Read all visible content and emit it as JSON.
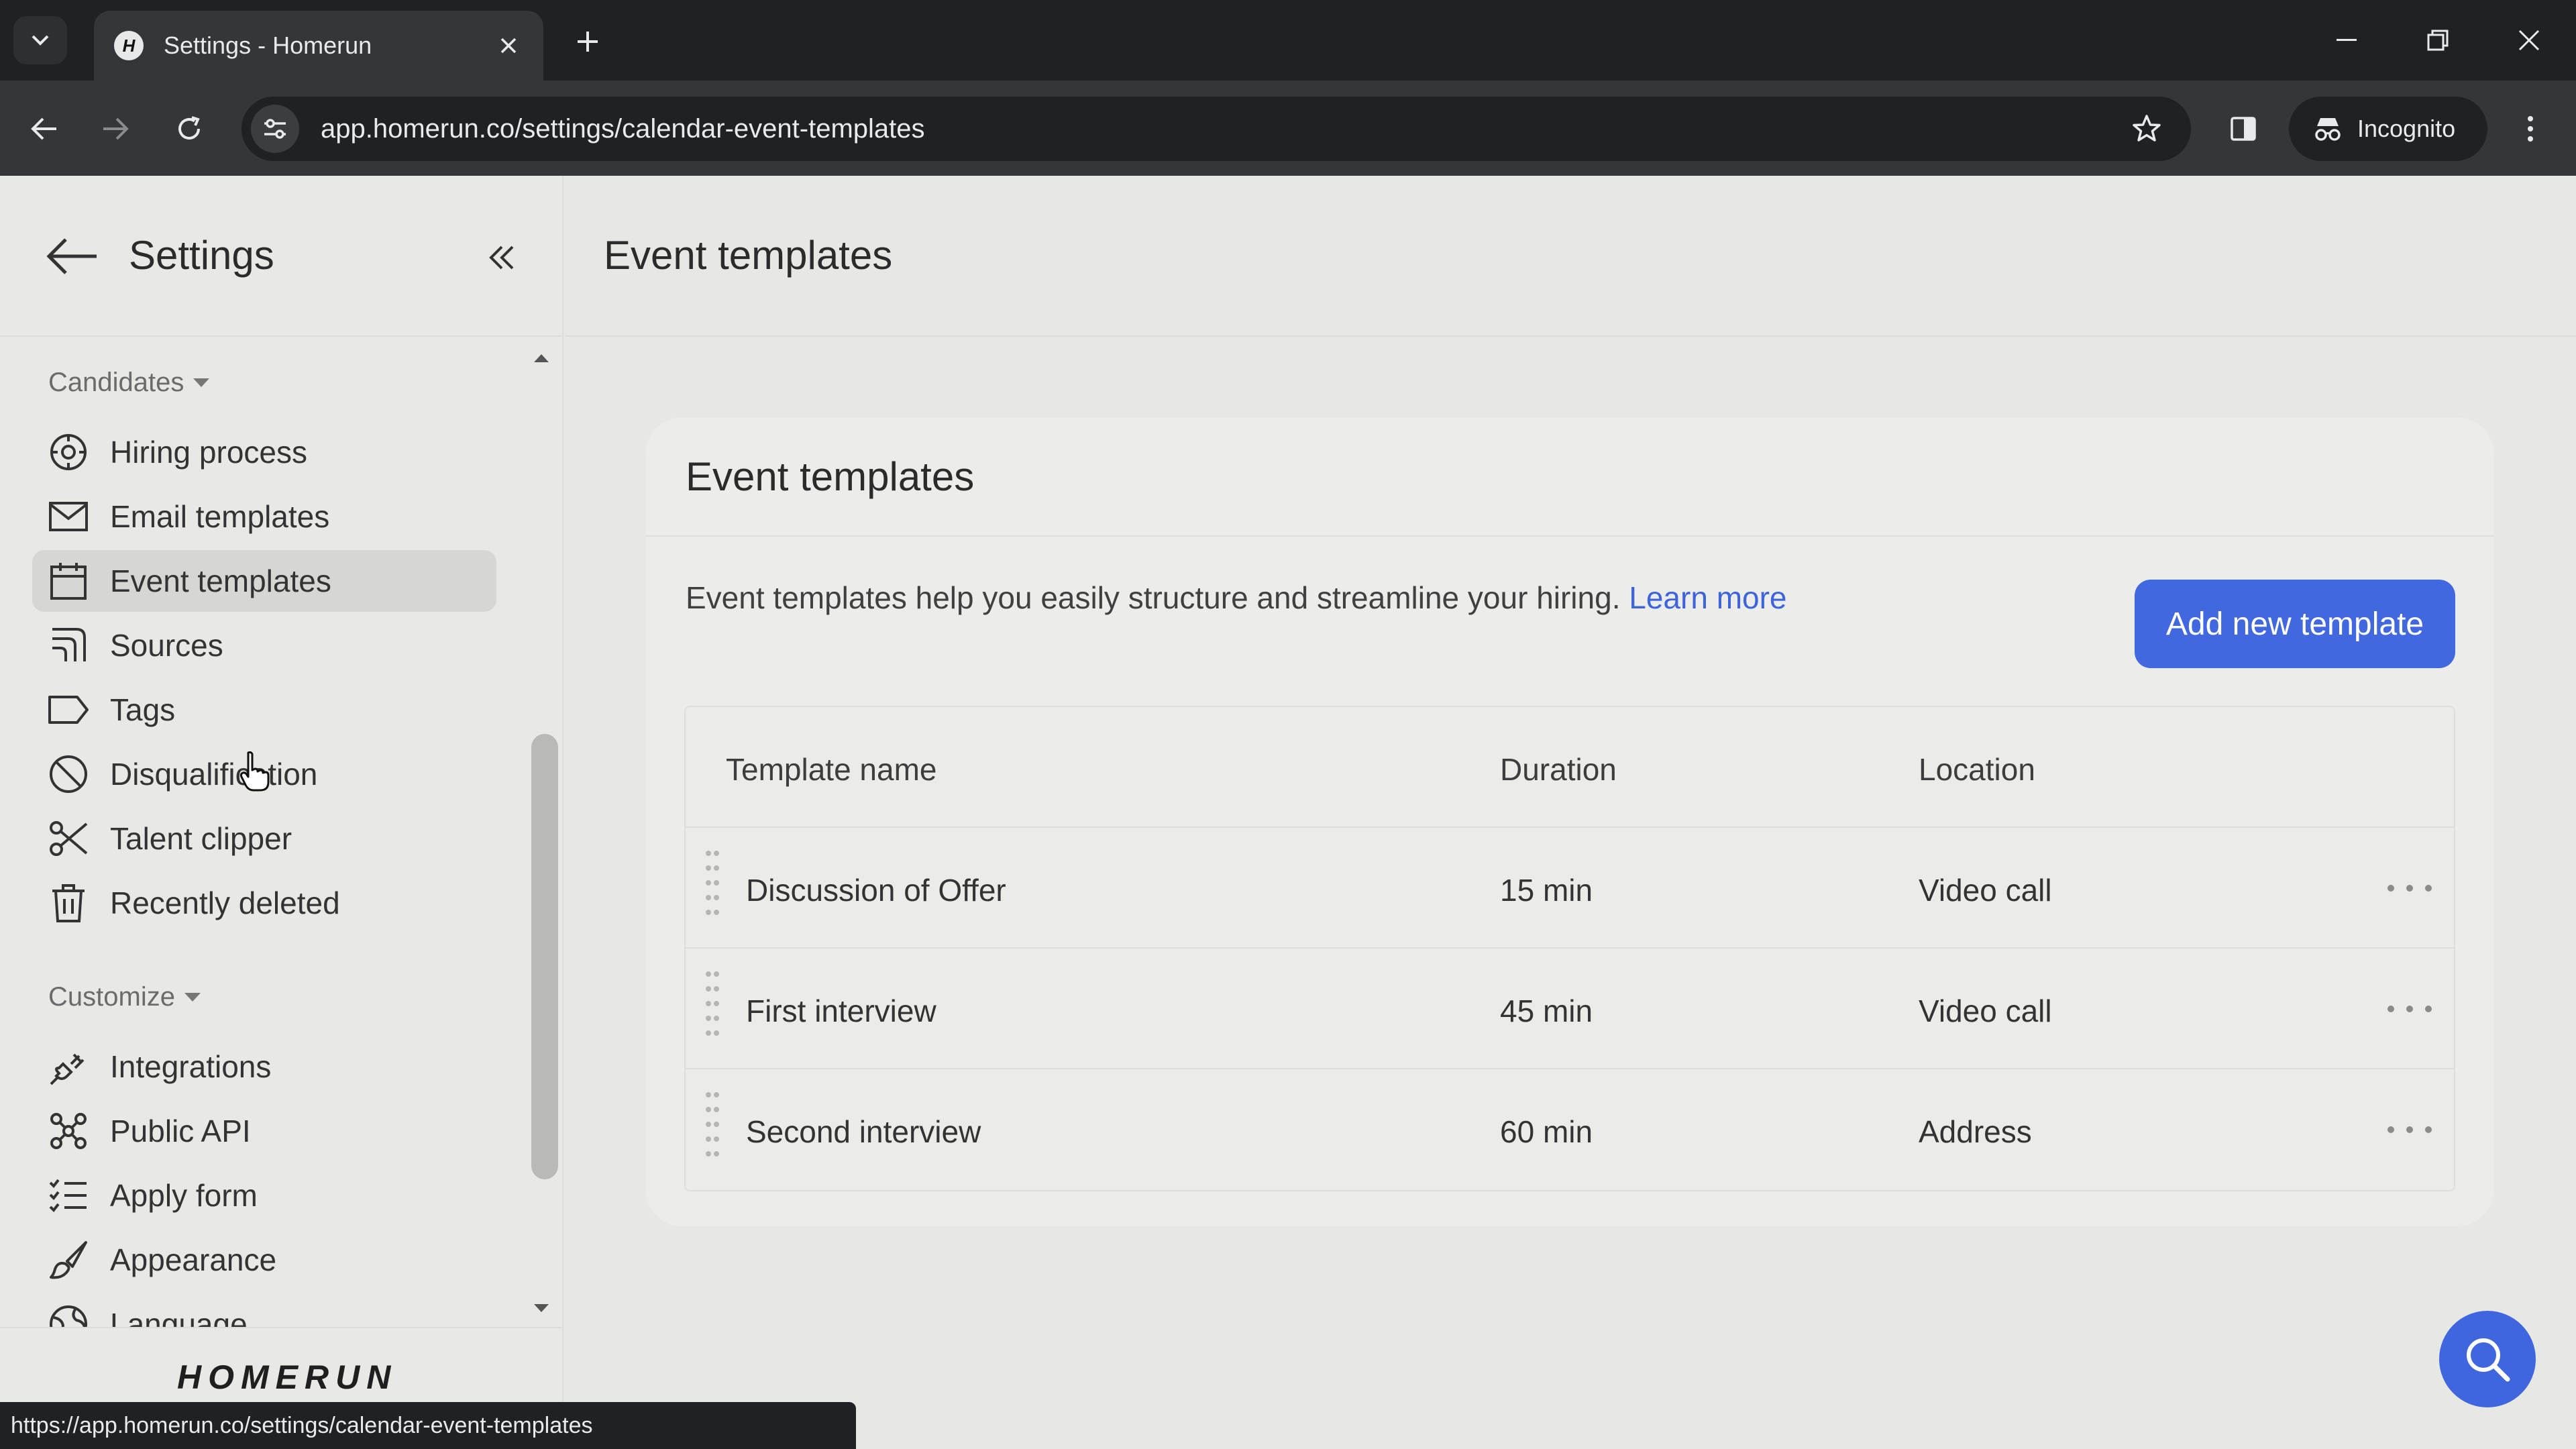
{
  "browser": {
    "tab_title": "Settings - Homerun",
    "favicon_letter": "H",
    "url": "app.homerun.co/settings/calendar-event-templates",
    "incognito_label": "Incognito",
    "status_url": "https://app.homerun.co/settings/calendar-event-templates"
  },
  "sidebar": {
    "title": "Settings",
    "sections": [
      {
        "label": "Candidates",
        "items": [
          {
            "label": "Hiring process",
            "icon": "target-icon"
          },
          {
            "label": "Email templates",
            "icon": "envelope-icon"
          },
          {
            "label": "Event templates",
            "icon": "calendar-icon",
            "active": true
          },
          {
            "label": "Sources",
            "icon": "sources-icon"
          },
          {
            "label": "Tags",
            "icon": "tag-icon"
          },
          {
            "label": "Disqualification",
            "icon": "ban-icon"
          },
          {
            "label": "Talent clipper",
            "icon": "scissors-icon"
          },
          {
            "label": "Recently deleted",
            "icon": "trash-icon"
          }
        ]
      },
      {
        "label": "Customize",
        "items": [
          {
            "label": "Integrations",
            "icon": "plug-icon"
          },
          {
            "label": "Public API",
            "icon": "network-icon"
          },
          {
            "label": "Apply form",
            "icon": "checklist-icon"
          },
          {
            "label": "Appearance",
            "icon": "brush-icon"
          },
          {
            "label": "Language",
            "icon": "globe-icon"
          }
        ]
      }
    ],
    "brand": "HOMERUN"
  },
  "main": {
    "page_title": "Event templates",
    "card": {
      "title": "Event templates",
      "description": "Event templates help you easily structure and streamline your hiring.",
      "learn_more": "Learn more",
      "add_button": "Add new template",
      "columns": [
        "Template name",
        "Duration",
        "Location"
      ],
      "rows": [
        {
          "name": "Discussion of Offer",
          "duration": "15 min",
          "location": "Video call"
        },
        {
          "name": "First interview",
          "duration": "45 min",
          "location": "Video call"
        },
        {
          "name": "Second interview",
          "duration": "60 min",
          "location": "Address"
        }
      ]
    }
  },
  "colors": {
    "accent": "#4268e0",
    "link": "#3d64d8",
    "chrome_dark": "#202124",
    "chrome_mid": "#35363a"
  }
}
